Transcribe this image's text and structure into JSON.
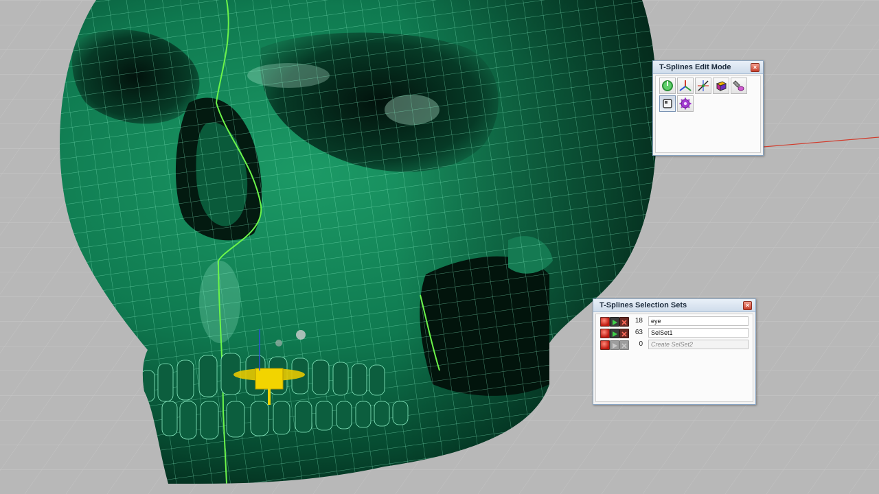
{
  "edit_mode_panel": {
    "title": "T-Splines Edit Mode",
    "close_symbol": "×",
    "tools": [
      {
        "icon": "power-toggle-icon",
        "pressed": false
      },
      {
        "icon": "manipulator-axes-icon",
        "pressed": false
      },
      {
        "icon": "transform-gumball-icon",
        "pressed": false
      },
      {
        "icon": "cube-vertex-icon",
        "pressed": false
      },
      {
        "icon": "brush-paint-icon",
        "pressed": false
      },
      {
        "icon": "face-mode-icon",
        "pressed": true
      },
      {
        "icon": "gear-settings-icon",
        "pressed": false
      }
    ]
  },
  "selection_sets_panel": {
    "title": "T-Splines Selection Sets",
    "close_symbol": "×",
    "rows": [
      {
        "count": "18",
        "name": "eye",
        "placeholder": "",
        "enabled": true
      },
      {
        "count": "63",
        "name": "SelSet1",
        "placeholder": "",
        "enabled": true
      },
      {
        "count": "0",
        "name": "",
        "placeholder": "Create SelSet2",
        "enabled": false
      }
    ]
  },
  "colors": {
    "viewport_bg": "#b8b8b8",
    "skull_green": "#0e7a4f",
    "wire_color": "#8ef0c6",
    "seam_color": "#6cf54a",
    "x_axis": "#d23a2a"
  }
}
